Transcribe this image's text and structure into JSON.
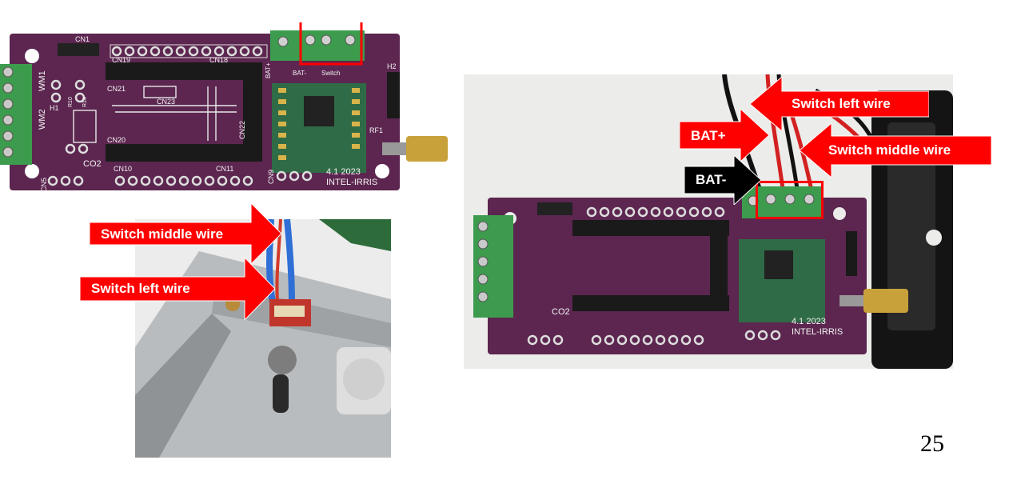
{
  "slide": {
    "page_number": "25"
  },
  "board_photo": {
    "silkscreen": {
      "connectors": [
        "CN1",
        "CN19",
        "CN18",
        "CN21",
        "CN23",
        "CN22",
        "CN20",
        "CN5",
        "CN10",
        "CN11",
        "CN9",
        "H2",
        "H1",
        "RF1",
        "WM2",
        "WM1",
        "R10",
        "R14"
      ],
      "labels": [
        "BAT+",
        "BAT-",
        "Switch",
        "CO2"
      ],
      "version": "4.1 2023",
      "brand": "INTEL-IRRIS"
    }
  },
  "switch_photo": {
    "arrows": [
      {
        "label": "Switch middle wire",
        "color": "#ff0000"
      },
      {
        "label": "Switch left wire",
        "color": "#ff0000"
      }
    ]
  },
  "wiring_photo": {
    "arrows": [
      {
        "label": "Switch left wire",
        "color": "#ff0000"
      },
      {
        "label": "BAT+",
        "color": "#ff0000"
      },
      {
        "label": "Switch middle wire",
        "color": "#ff0000"
      },
      {
        "label": "BAT-",
        "color": "#000000"
      }
    ]
  },
  "colors": {
    "pcb": "#5c2650",
    "highlight": "#ff0000",
    "terminal": "#3d9b4e"
  }
}
